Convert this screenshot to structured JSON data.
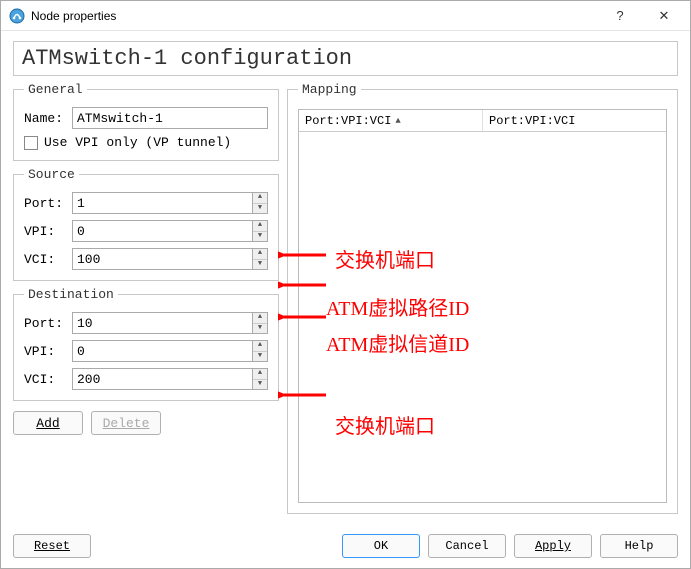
{
  "window": {
    "title": "Node properties",
    "help_btn": "?",
    "close_btn": "✕"
  },
  "header": {
    "title": "ATMswitch-1 configuration"
  },
  "general": {
    "legend": "General",
    "name_label": "Name:",
    "name_value": "ATMswitch-1",
    "use_vpi_label": "Use VPI only (VP tunnel)",
    "use_vpi_checked": false
  },
  "source": {
    "legend": "Source",
    "port_label": "Port:",
    "port_value": "1",
    "vpi_label": "VPI:",
    "vpi_value": "0",
    "vci_label": "VCI:",
    "vci_value": "100"
  },
  "destination": {
    "legend": "Destination",
    "port_label": "Port:",
    "port_value": "10",
    "vpi_label": "VPI:",
    "vpi_value": "0",
    "vci_label": "VCI:",
    "vci_value": "200"
  },
  "actions": {
    "add": "Add",
    "delete": "Delete"
  },
  "mapping": {
    "legend": "Mapping",
    "col1": "Port:VPI:VCI",
    "col2": "Port:VPI:VCI"
  },
  "bottom": {
    "reset": "Reset",
    "ok": "OK",
    "cancel": "Cancel",
    "apply": "Apply",
    "help": "Help"
  },
  "annotations": {
    "src_port": "交换机端口",
    "src_vpi": "ATM虚拟路径ID",
    "src_vci": "ATM虚拟信道ID",
    "dst_port": "交换机端口"
  }
}
